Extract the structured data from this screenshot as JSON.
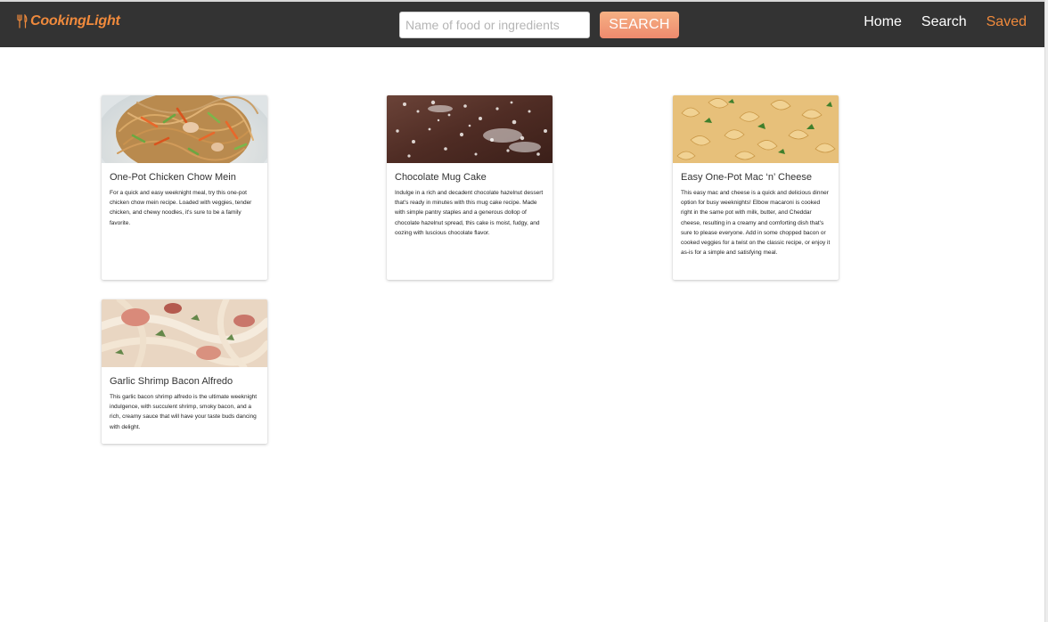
{
  "brand": {
    "name": "CookingLight",
    "icon": "fork-knife-icon",
    "color": "#f08a3c"
  },
  "search": {
    "placeholder": "Name of food or ingredients",
    "value": "",
    "button_label": "SEARCH"
  },
  "nav": {
    "items": [
      {
        "label": "Home",
        "active": false
      },
      {
        "label": "Search",
        "active": false
      },
      {
        "label": "Saved",
        "active": true
      }
    ]
  },
  "colors": {
    "navbar_bg": "#333333",
    "accent": "#f08a3c",
    "button_gradient_top": "#f6b184",
    "button_gradient_bottom": "#ee8a6e"
  },
  "recipes": [
    {
      "title": "One-Pot Chicken Chow Mein",
      "description": "For a quick and easy weeknight meal, try this one-pot chicken chow mein recipe. Loaded with veggies, tender chicken, and chewy noodles, it's sure to be a family favorite.",
      "image": "chow-mein-photo"
    },
    {
      "title": "Chocolate Mug Cake",
      "description": "Indulge in a rich and decadent chocolate hazelnut dessert that's ready in minutes with this mug cake recipe. Made with simple pantry staples and a generous dollop of chocolate hazelnut spread, this cake is moist, fudgy, and oozing with luscious chocolate flavor.",
      "image": "mug-cake-photo"
    },
    {
      "title": "Easy One-Pot Mac ‘n’ Cheese",
      "description": "This easy mac and cheese is a quick and delicious dinner option for busy weeknights! Elbow macaroni is cooked right in the same pot with milk, butter, and Cheddar cheese, resulting in a creamy and comforting dish that's sure to please everyone. Add in some chopped bacon or cooked veggies for a twist on the classic recipe, or enjoy it as-is for a simple and satisfying meal.",
      "image": "mac-cheese-photo"
    },
    {
      "title": "Garlic Shrimp Bacon Alfredo",
      "description": "This garlic bacon shrimp alfredo is the ultimate weeknight indulgence, with succulent shrimp, smoky bacon, and a rich, creamy sauce that will have your taste buds dancing with delight.",
      "image": "alfredo-photo"
    }
  ]
}
